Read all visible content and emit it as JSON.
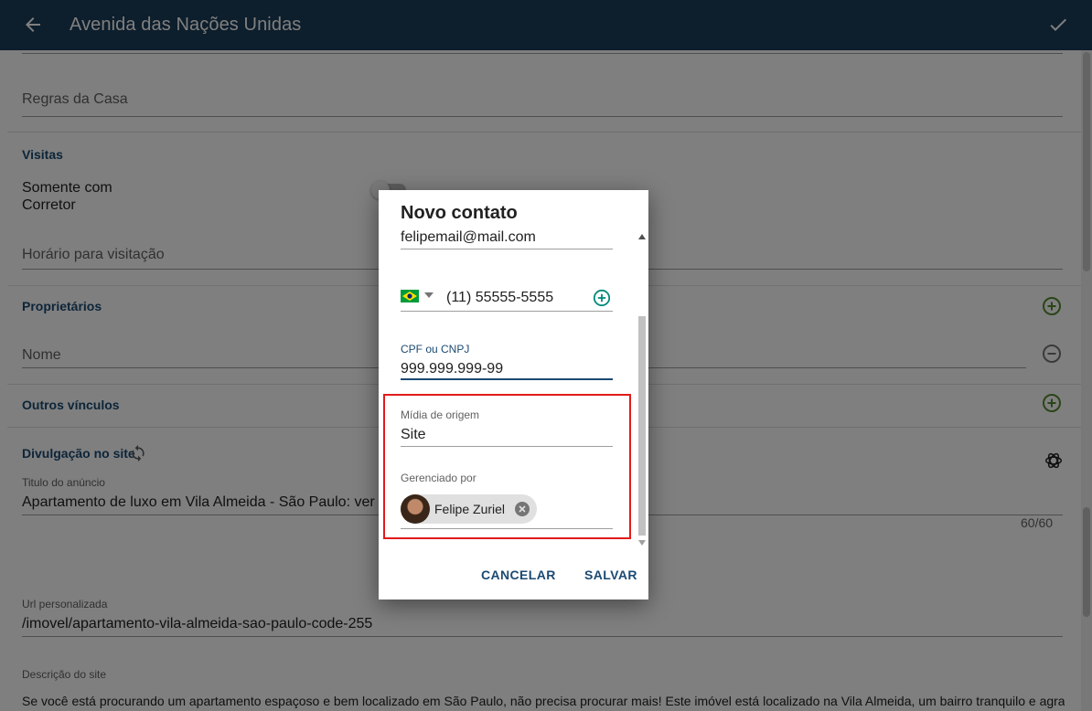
{
  "appbar": {
    "title": "Avenida das Nações Unidas",
    "back_icon": "arrow-left-icon",
    "confirm_icon": "check-icon"
  },
  "form": {
    "house_rules_placeholder": "Regras da Casa",
    "visits_section": "Visitas",
    "broker_only_label_line1": "Somente com",
    "broker_only_label_line2": "Corretor",
    "visiting_hours_placeholder": "Horário para visitação",
    "owners_section": "Proprietários",
    "owner_name_placeholder": "Nome",
    "other_links_section": "Outros vínculos",
    "site_section": "Divulgação no site",
    "ad_title_label": "Titulo do anúncio",
    "ad_title_value": "Apartamento de luxo em Vila Almeida - São Paulo: ver",
    "ad_title_counter": "60/60",
    "custom_url_label": "Url personalizada",
    "custom_url_value": "/imovel/apartamento-vila-almeida-sao-paulo-code-255",
    "site_description_label": "Descrição do site",
    "site_description_value": "Se você está procurando um apartamento espaçoso e bem localizado em São Paulo, não precisa procurar mais! Este imóvel está localizado na Vila Almeida, um bairro tranquilo e agradável,"
  },
  "dialog": {
    "title": "Novo contato",
    "email_value": "felipemail@mail.com",
    "phone_value": "(11) 55555-5555",
    "cpf_label": "CPF ou CNPJ",
    "cpf_value": "999.999.999-99",
    "origin_media_label": "Mídia de origem",
    "origin_media_value": "Site",
    "managed_by_label": "Gerenciado por",
    "managed_by_chip": "Felipe Zuriel",
    "cancel_label": "CANCELAR",
    "save_label": "SALVAR"
  },
  "colors": {
    "appbar": "#1b3c59",
    "section_title": "#1b4a72",
    "add_green": "#558b2f",
    "highlight_red": "#e21b1b"
  }
}
